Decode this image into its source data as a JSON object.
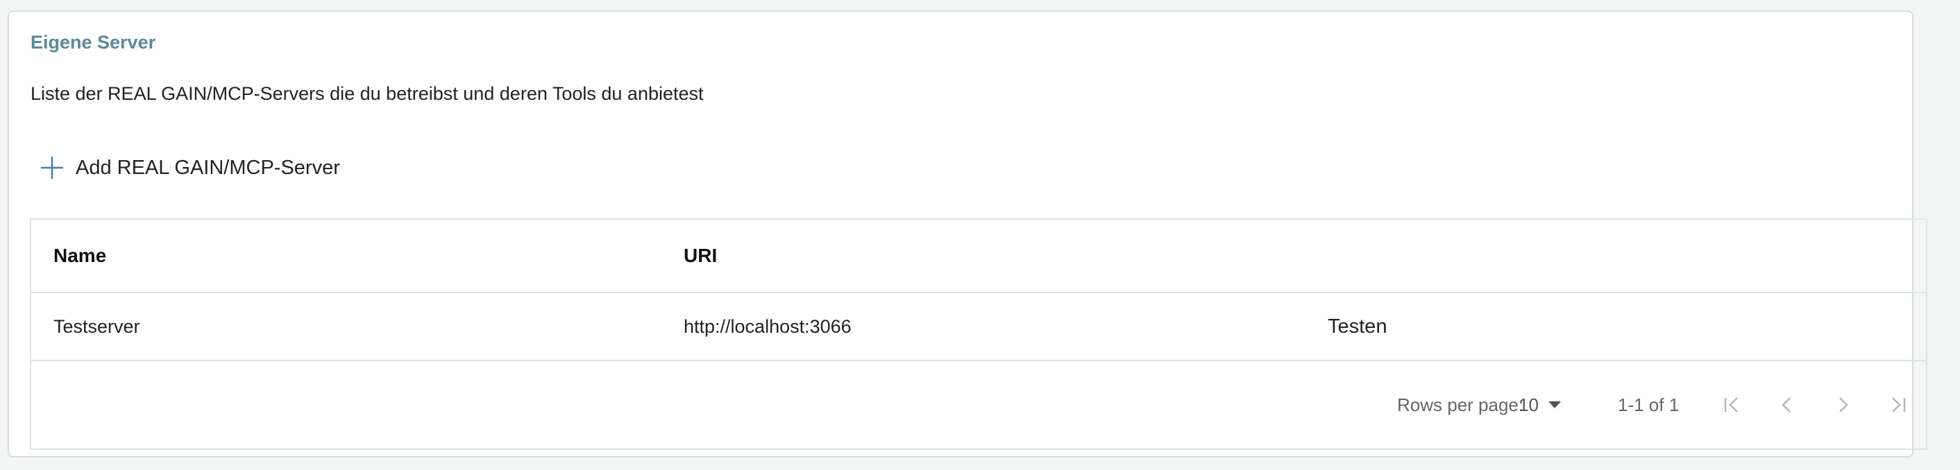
{
  "card": {
    "title": "Eigene Server",
    "description": "Liste der REAL GAIN/MCP-Servers die du betreibst und deren Tools du anbietest",
    "add_button_label": "Add REAL GAIN/MCP-Server",
    "add_icon": "plus-icon"
  },
  "table": {
    "columns": [
      "Name",
      "URI",
      ""
    ],
    "rows": [
      {
        "name": "Testserver",
        "uri": "http://localhost:3066",
        "action": "Testen"
      }
    ]
  },
  "pagination": {
    "rows_per_page_label": "Rows per page:",
    "rows_per_page_value": "10",
    "range_text": "1-1 of 1",
    "icons": [
      "first-page-icon",
      "previous-page-icon",
      "next-page-icon",
      "last-page-icon"
    ]
  },
  "colors": {
    "title": "#5b8a98",
    "accent": "#3f7fb0",
    "disabled_icon": "#b7b7b7"
  }
}
